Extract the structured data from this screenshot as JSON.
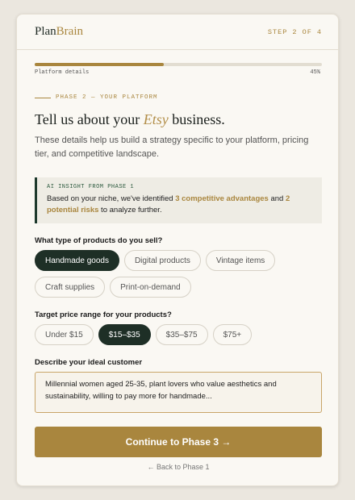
{
  "header": {
    "logo_part1": "Plan",
    "logo_part2": "Brain",
    "step": "STEP 2 OF 4"
  },
  "progress": {
    "label": "Platform details",
    "percent_label": "45%",
    "value": 0.45
  },
  "phase": {
    "label": "PHASE 2 — YOUR PLATFORM"
  },
  "title": {
    "before": "Tell us about your ",
    "platform": "Etsy",
    "after": " business."
  },
  "subtitle": "These details help us build a strategy specific to your platform, pricing tier, and competitive landscape.",
  "insight": {
    "label": "AI INSIGHT FROM PHASE 1",
    "text_1": "Based on your niche, we've identified ",
    "highlight_1": "3 competitive advantages",
    "text_2": " and ",
    "highlight_2": "2 potential risks",
    "text_3": " to analyze further."
  },
  "products": {
    "question": "What type of products do you sell?",
    "options": [
      "Handmade goods",
      "Digital products",
      "Vintage items",
      "Craft supplies",
      "Print-on-demand"
    ],
    "selected": "Handmade goods"
  },
  "price": {
    "question": "Target price range for your products?",
    "options": [
      "Under $15",
      "$15–$35",
      "$35–$75",
      "$75+"
    ],
    "selected": "$15–$35"
  },
  "customer": {
    "question": "Describe your ideal customer",
    "value": "Millennial women aged 25-35, plant lovers who value aesthetics and sustainability, willing to pay more for handmade..."
  },
  "actions": {
    "continue_label": "Continue to Phase 3 →",
    "back_label": "← Back to Phase 1"
  },
  "colors": {
    "accent": "#a9863e",
    "dark": "#1e2f26",
    "background": "#faf8f3"
  }
}
